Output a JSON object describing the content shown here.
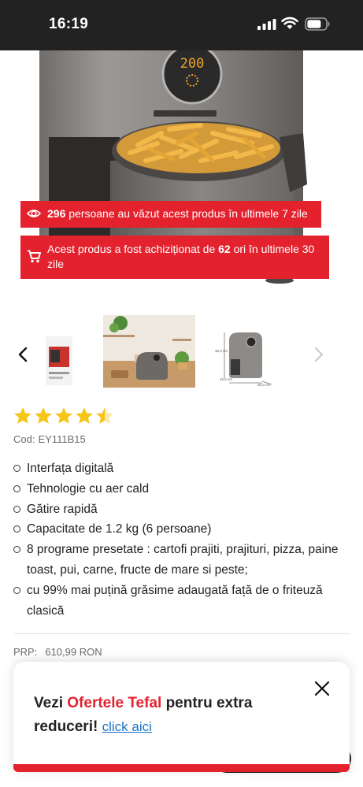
{
  "status_bar": {
    "time": "16:19",
    "icons": [
      "cellular-signal-icon",
      "wifi-icon",
      "battery-icon"
    ]
  },
  "hero": {
    "display_readout": "200",
    "image": "air-fryer-with-fries-photo"
  },
  "banners": {
    "views": {
      "icon": "eye-icon",
      "count": "296",
      "text": "persoane au văzut acest produs în ultimele 7 zile"
    },
    "bought": {
      "icon": "shopping-cart-icon",
      "prefix": "Acest produs a fost achiziționat de",
      "count": "62",
      "suffix": "ori în ultimele 30 zile"
    }
  },
  "carousel": {
    "prev_icon": "chevron-left-icon",
    "next_icon": "chevron-right-icon",
    "thumbnails": [
      "product-box-thumbnail",
      "kitchen-scene-thumbnail",
      "dimensions-drawing-thumbnail"
    ],
    "dimension_labels": [
      "36,3 cm",
      "42,5 cm",
      "30,3 cm"
    ]
  },
  "rating": {
    "stars": 4.5,
    "max": 5,
    "color": "#f5c518"
  },
  "sku": {
    "label": "Cod:",
    "value": "EY111B15"
  },
  "features": [
    "Interfața digitală",
    "Tehnologie cu aer cald",
    "Gătire rapidă",
    "Capacitate de 1.2 kg (6 persoane)",
    "8 programe presetate : cartofi prajiti, prajituri, pizza, paine toast, pui, carne, fructe de mare si peste;",
    "cu 99% mai puțină grăsime adaugată față de o friteuză clasică"
  ],
  "price": {
    "label": "PRP:",
    "value": "610,99 RON"
  },
  "popup": {
    "text_before": "Vezi",
    "brand_text": "Ofertele Tefal",
    "text_after": "pentru extra reduceri!",
    "link_label": "click aici",
    "close_icon": "close-icon"
  },
  "colors": {
    "accent_red": "#e3222e",
    "link_blue": "#1a73c8",
    "status_bar_bg": "#222222"
  }
}
